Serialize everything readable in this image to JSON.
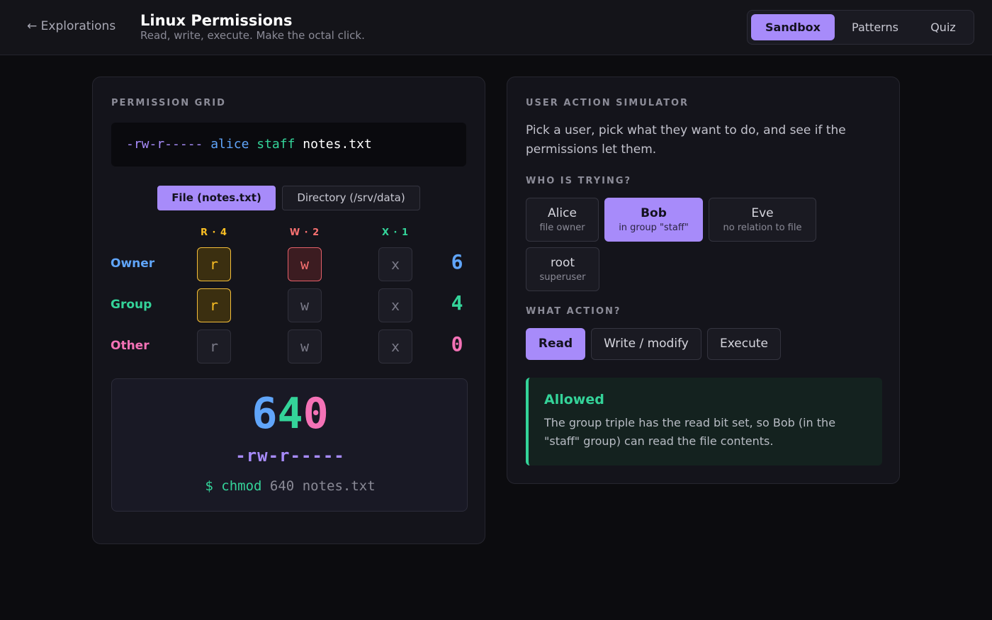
{
  "header": {
    "back_label": "← Explorations",
    "title": "Linux Permissions",
    "subtitle": "Read, write, execute. Make the octal click.",
    "tabs": [
      {
        "label": "Sandbox",
        "active": true
      },
      {
        "label": "Patterns",
        "active": false
      },
      {
        "label": "Quiz",
        "active": false
      }
    ]
  },
  "grid_panel": {
    "section_label": "PERMISSION GRID",
    "ls_line": {
      "permissions": "-rw-r-----",
      "owner": "alice",
      "group": "staff",
      "filename": "notes.txt"
    },
    "modes": [
      {
        "label": "File (notes.txt)",
        "active": true
      },
      {
        "label": "Directory (/srv/data)",
        "active": false
      }
    ],
    "columns": [
      {
        "label": "R · 4",
        "color": "#fbbf24"
      },
      {
        "label": "W · 2",
        "color": "#f87171"
      },
      {
        "label": "X · 1",
        "color": "#34d399"
      }
    ],
    "rows": [
      {
        "label": "Owner",
        "color": "#60a5fa",
        "digit": "6",
        "bits": [
          "r",
          "w",
          "x"
        ],
        "set": [
          true,
          true,
          false
        ]
      },
      {
        "label": "Group",
        "color": "#34d399",
        "digit": "4",
        "bits": [
          "r",
          "w",
          "x"
        ],
        "set": [
          true,
          false,
          false
        ]
      },
      {
        "label": "Other",
        "color": "#f472b6",
        "digit": "0",
        "bits": [
          "r",
          "w",
          "x"
        ],
        "set": [
          false,
          false,
          false
        ]
      }
    ],
    "octal": {
      "digits": [
        "6",
        "4",
        "0"
      ],
      "symbolic": "-rw-r-----",
      "prompt": "$",
      "command": "chmod",
      "mode": "640",
      "target": "notes.txt"
    }
  },
  "simulator_panel": {
    "section_label": "USER ACTION SIMULATOR",
    "intro": "Pick a user, pick what they want to do, and see if the permissions let them.",
    "who_label": "WHO IS TRYING?",
    "users": [
      {
        "name": "Alice",
        "sub": "file owner",
        "active": false
      },
      {
        "name": "Bob",
        "sub": "in group \"staff\"",
        "active": true
      },
      {
        "name": "Eve",
        "sub": "no relation to file",
        "active": false
      },
      {
        "name": "root",
        "sub": "superuser",
        "active": false
      }
    ],
    "action_label": "WHAT ACTION?",
    "actions": [
      {
        "label": "Read",
        "active": true
      },
      {
        "label": "Write / modify",
        "active": false
      },
      {
        "label": "Execute",
        "active": false
      }
    ],
    "result": {
      "title": "Allowed",
      "text": "The group triple has the read bit set, so Bob (in the \"staff\" group) can read the file contents."
    }
  },
  "colors": {
    "accent": "#a78bfa",
    "owner": "#60a5fa",
    "group": "#34d399",
    "other": "#f472b6",
    "read": "#fbbf24",
    "write": "#f87171",
    "execute": "#34d399",
    "allowed": "#34d399"
  }
}
